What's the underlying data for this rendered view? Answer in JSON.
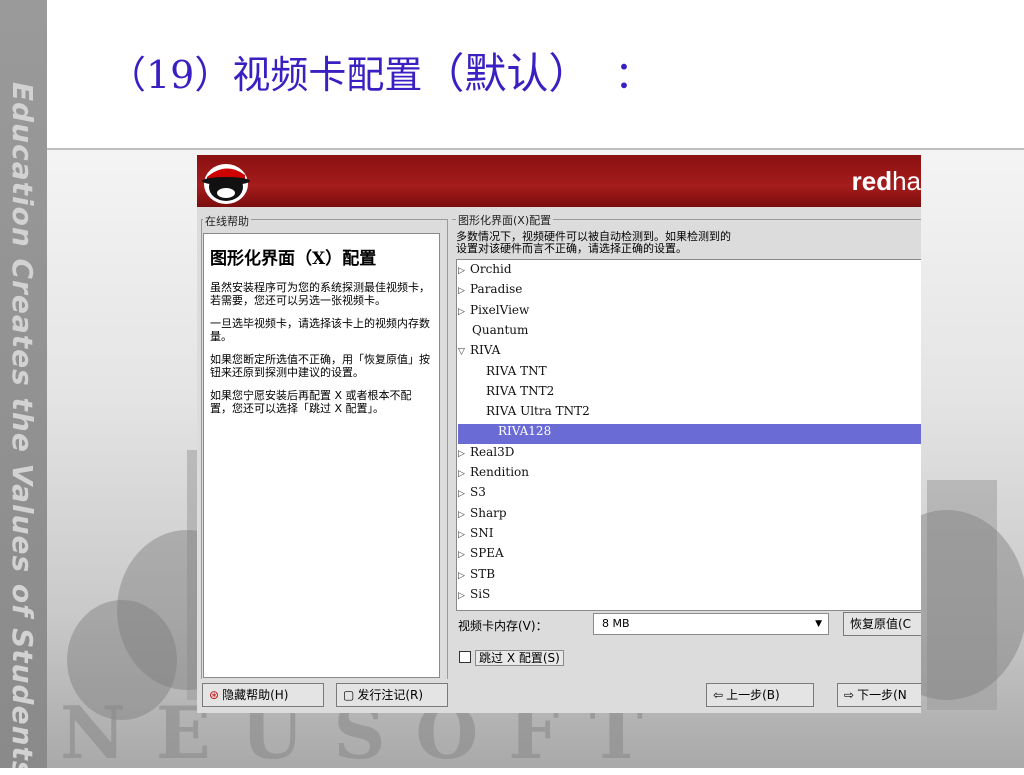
{
  "slide": {
    "title_prefix": "（19）视频卡配置",
    "title_suffix": "（默认）",
    "title_colon": "：",
    "side_text": "Education Creates the Values of Students",
    "bg_letters": "NEUSOFT"
  },
  "installer": {
    "brand_bold": "red",
    "brand_light": "ha",
    "help": {
      "frame_label": "在线帮助",
      "heading": "图形化界面（X）配置",
      "paragraphs": [
        "虽然安装程序可为您的系统探测最佳视频卡，若需要，您还可以另选一张视频卡。",
        "一旦选毕视频卡，请选择该卡上的视频内存数量。",
        "如果您断定所选值不正确，用「恢复原值」按钮来还原到探测中建议的设置。",
        "如果您宁愿安装后再配置 X 或者根本不配置，您还可以选择「跳过 X 配置」。"
      ]
    },
    "config": {
      "frame_label": "图形化界面(X)配置",
      "intro_line1": "多数情况下，视频硬件可以被自动检测到。如果检测到的",
      "intro_line2": "设置对该硬件而言不正确，请选择正确的设置。",
      "cards": [
        {
          "label": "Orchid",
          "expander": "collapsed"
        },
        {
          "label": "Paradise",
          "expander": "collapsed"
        },
        {
          "label": "PixelView",
          "expander": "collapsed"
        },
        {
          "label": "Quantum",
          "expander": "none"
        },
        {
          "label": "RIVA",
          "expander": "expanded"
        },
        {
          "label": "RIVA TNT",
          "expander": "child"
        },
        {
          "label": "RIVA TNT2",
          "expander": "child"
        },
        {
          "label": "RIVA Ultra TNT2",
          "expander": "child"
        },
        {
          "label": "RIVA128",
          "expander": "child",
          "selected": true
        },
        {
          "label": "Real3D",
          "expander": "collapsed"
        },
        {
          "label": "Rendition",
          "expander": "collapsed"
        },
        {
          "label": "S3",
          "expander": "collapsed"
        },
        {
          "label": "Sharp",
          "expander": "collapsed"
        },
        {
          "label": "SNI",
          "expander": "collapsed"
        },
        {
          "label": "SPEA",
          "expander": "collapsed"
        },
        {
          "label": "STB",
          "expander": "collapsed"
        },
        {
          "label": "SiS",
          "expander": "collapsed"
        }
      ],
      "memory_label": "视频卡内存(V)：",
      "memory_value": "8 MB",
      "restore_button": "恢复原值(C",
      "skip_checkbox": "跳过 X 配置(S)",
      "skip_checked": false
    },
    "buttons": {
      "hide_help": "隐藏帮助(H)",
      "release_notes": "发行注记(R)",
      "back": "上一步(B)",
      "next": "下一步(N"
    },
    "colors": {
      "banner": "#a51c1c",
      "selection": "#6b6bd6",
      "title": "#3b1fc2"
    }
  }
}
